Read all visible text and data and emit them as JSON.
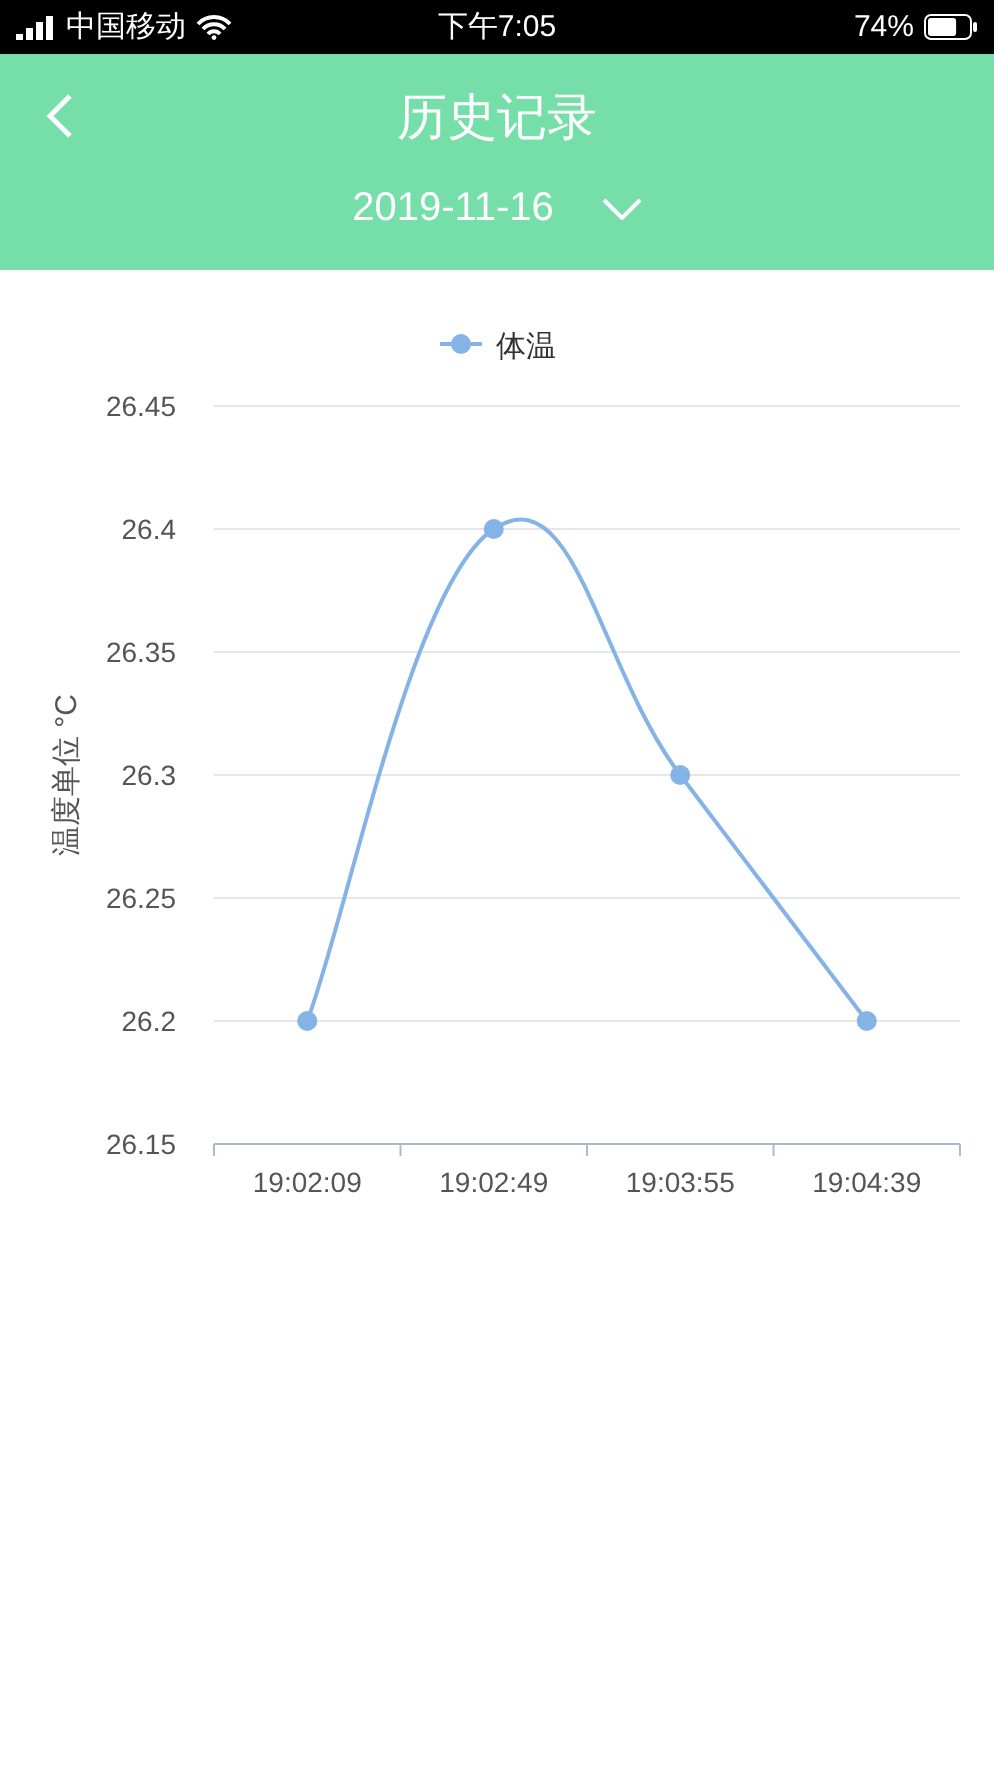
{
  "status_bar": {
    "carrier": "中国移动",
    "time": "下午7:05",
    "battery": "74%"
  },
  "header": {
    "title": "历史记录",
    "date": "2019-11-16"
  },
  "chart": {
    "chart_data": {
      "type": "line",
      "ylabel": "温度单位 °C",
      "categories": [
        "19:02:09",
        "19:02:49",
        "19:03:55",
        "19:04:39"
      ],
      "grid": true,
      "series": [
        {
          "name": "体温",
          "color": "#85b3e6",
          "marker": "circle",
          "values": [
            26.2,
            26.4,
            26.3,
            26.2
          ]
        }
      ],
      "ylim": [
        26.15,
        26.45
      ],
      "yticks": [
        26.15,
        {
          "value": 26.2,
          "label": "26.2"
        },
        26.25,
        26.3,
        26.35,
        {
          "value": 26.4,
          "label": "26.4"
        },
        26.45
      ]
    }
  }
}
